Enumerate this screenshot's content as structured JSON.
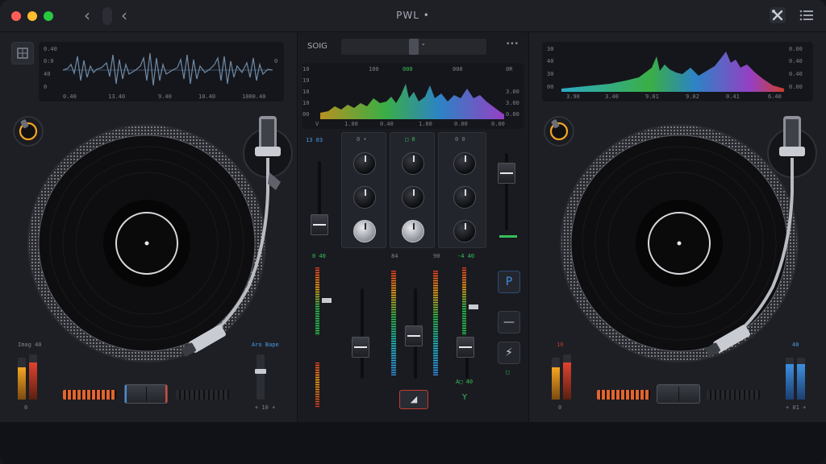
{
  "app": {
    "title": "PWL •"
  },
  "titlebar": {
    "back_glyph": "‹",
    "forward_glyph": "‹",
    "tools_icon": "wrench-cross-icon",
    "menu_icon": "list-icon"
  },
  "deck_left": {
    "wave_labels_left": [
      "0.40",
      "0:0",
      "40",
      "0"
    ],
    "wave_label_right": "0",
    "time_labels": [
      "0.40",
      "13.40",
      "9.40",
      "10.40",
      "1000.40"
    ],
    "bottom_left_label": "Imag 40",
    "bottom_right_label": "Aro Bape",
    "small_btn_label": "0",
    "bottom_right_small": "+ 10 +"
  },
  "deck_right": {
    "wave_labels_left": [
      "30",
      "40",
      "30",
      "00"
    ],
    "wave_labels_right": [
      "0.00",
      "0.40",
      "0.40",
      "0.00"
    ],
    "time_labels": [
      "3.90",
      "3.40",
      "9.01",
      "9.02",
      "0.41",
      "6.40"
    ],
    "bottom_left_label": "10",
    "bottom_right_label": "40",
    "small_btn_label": "0",
    "bottom_right_small": "+ 01 +"
  },
  "mixer": {
    "song_label": "SOIG",
    "crossfader_glyph": "-",
    "more_glyph": "•••",
    "spec_labels_left": [
      "10",
      "19",
      "10",
      "10",
      "00"
    ],
    "spec_labels_top": [
      "100",
      "000",
      "000",
      "0R"
    ],
    "spec_labels_right": [
      "3.00",
      "3.00",
      "0.00"
    ],
    "spec_time_labels": [
      "V",
      "1.00",
      "0.40",
      "1.00",
      "0.00",
      "0.00"
    ],
    "channel_headers": [
      "13 03",
      "0 •",
      "□ 0",
      "0 0"
    ],
    "meter_labels": [
      "0 40",
      "84",
      "90",
      "-4 40"
    ],
    "side_btn_p": "P",
    "side_btn_minus": "—",
    "side_btn_flash": "⚡",
    "eject_glyph": "◢",
    "bottom_y": "Y",
    "bottom_note": "A□ 40",
    "ch_label_right": "□"
  },
  "colors": {
    "accent_orange": "#f5a623",
    "meter_green": "#35c05a",
    "meter_red": "#e0432f",
    "accent_blue": "#3d8fe0"
  }
}
